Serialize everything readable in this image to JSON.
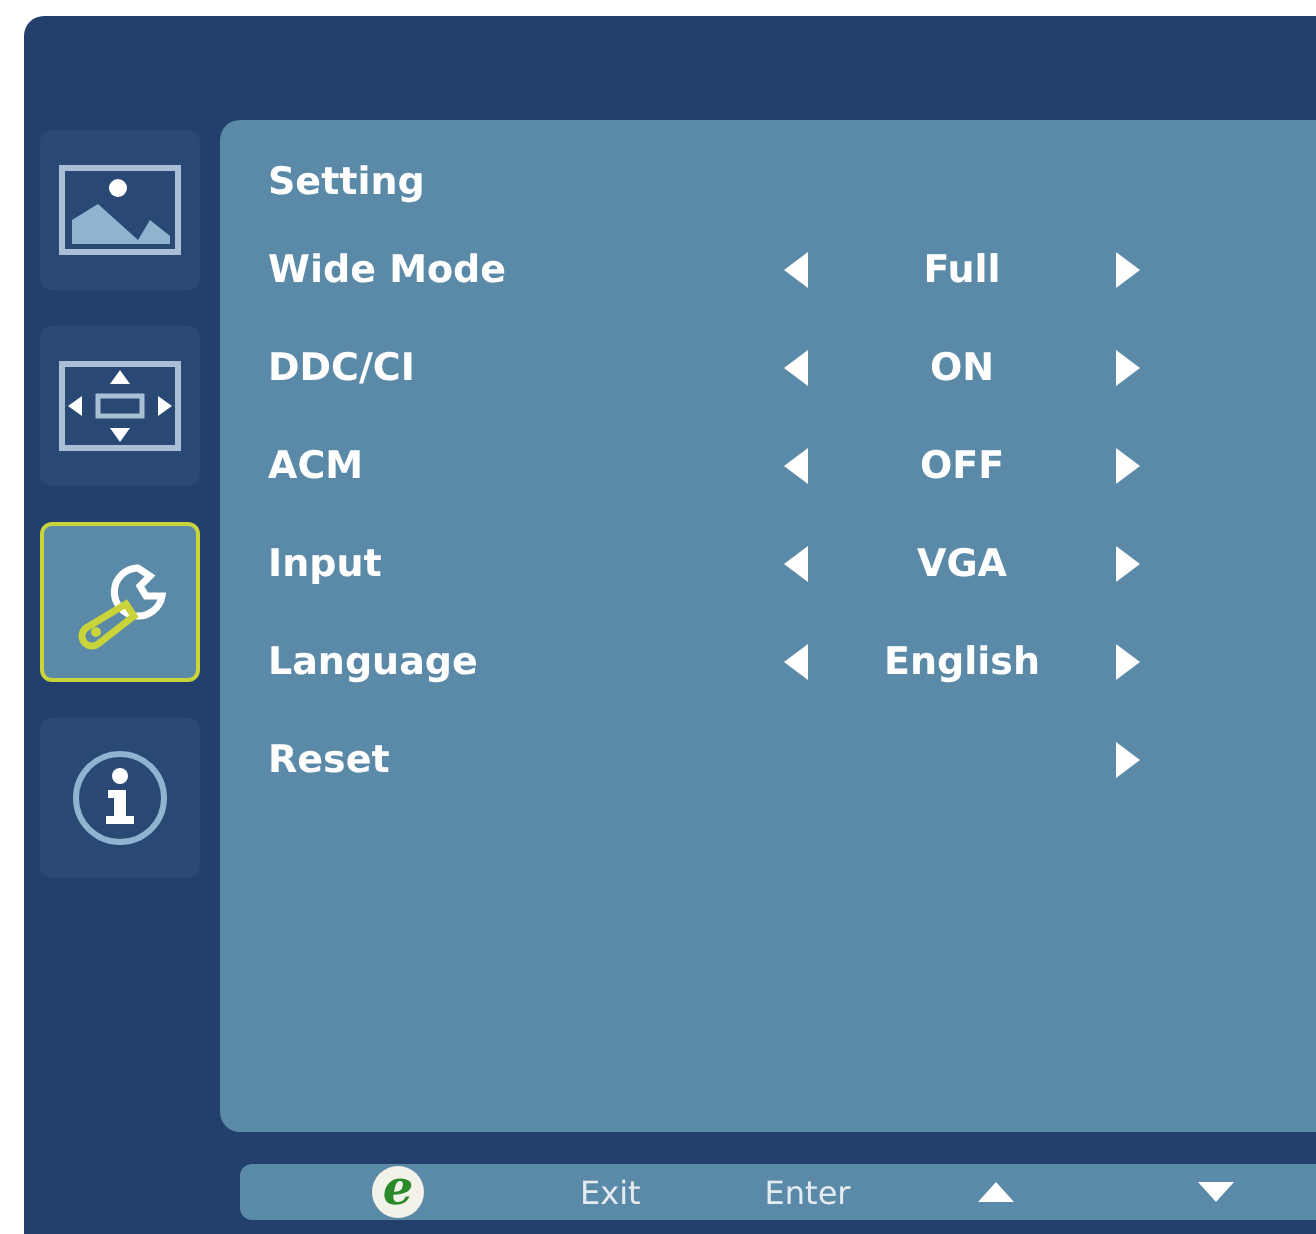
{
  "tabs": [
    {
      "kind": "picture",
      "selected": false
    },
    {
      "kind": "display",
      "selected": false
    },
    {
      "kind": "settings",
      "selected": true
    },
    {
      "kind": "info",
      "selected": false
    }
  ],
  "panel": {
    "title": "Setting",
    "rows": [
      {
        "label": "Wide Mode",
        "value": "Full"
      },
      {
        "label": "DDC/CI",
        "value": "ON"
      },
      {
        "label": "ACM",
        "value": "OFF"
      },
      {
        "label": "Input",
        "value": "VGA"
      },
      {
        "label": "Language",
        "value": "English"
      },
      {
        "label": "Reset"
      }
    ]
  },
  "footer": [
    {
      "kind": "logo",
      "text": "e"
    },
    {
      "kind": "text",
      "text": "Exit"
    },
    {
      "kind": "text",
      "text": "Enter"
    },
    {
      "kind": "up"
    },
    {
      "kind": "down"
    }
  ]
}
